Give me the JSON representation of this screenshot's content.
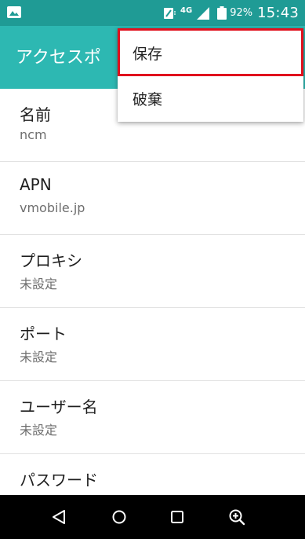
{
  "status_bar": {
    "network_label": "4G",
    "battery_percent": "92%",
    "time": "15:43",
    "icons": [
      "gallery-icon",
      "nfc-icon",
      "signal-icon",
      "battery-icon"
    ]
  },
  "action_bar": {
    "title": "アクセスポ"
  },
  "overflow_menu": {
    "items": [
      {
        "label": "保存",
        "highlighted": true
      },
      {
        "label": "破棄",
        "highlighted": false
      }
    ],
    "highlight_color": "#e0101d"
  },
  "settings": [
    {
      "label": "名前",
      "value": "ncm"
    },
    {
      "label": "APN",
      "value": "vmobile.jp"
    },
    {
      "label": "プロキシ",
      "value": "未設定"
    },
    {
      "label": "ポート",
      "value": "未設定"
    },
    {
      "label": "ユーザー名",
      "value": "未設定"
    },
    {
      "label": "パスワード",
      "value": ""
    }
  ],
  "nav_bar": {
    "icons": [
      "back-icon",
      "home-icon",
      "recent-apps-icon",
      "zoom-icon"
    ]
  },
  "colors": {
    "status_bar": "#1f9b95",
    "action_bar": "#2db8b2",
    "nav_bar": "#000000"
  }
}
